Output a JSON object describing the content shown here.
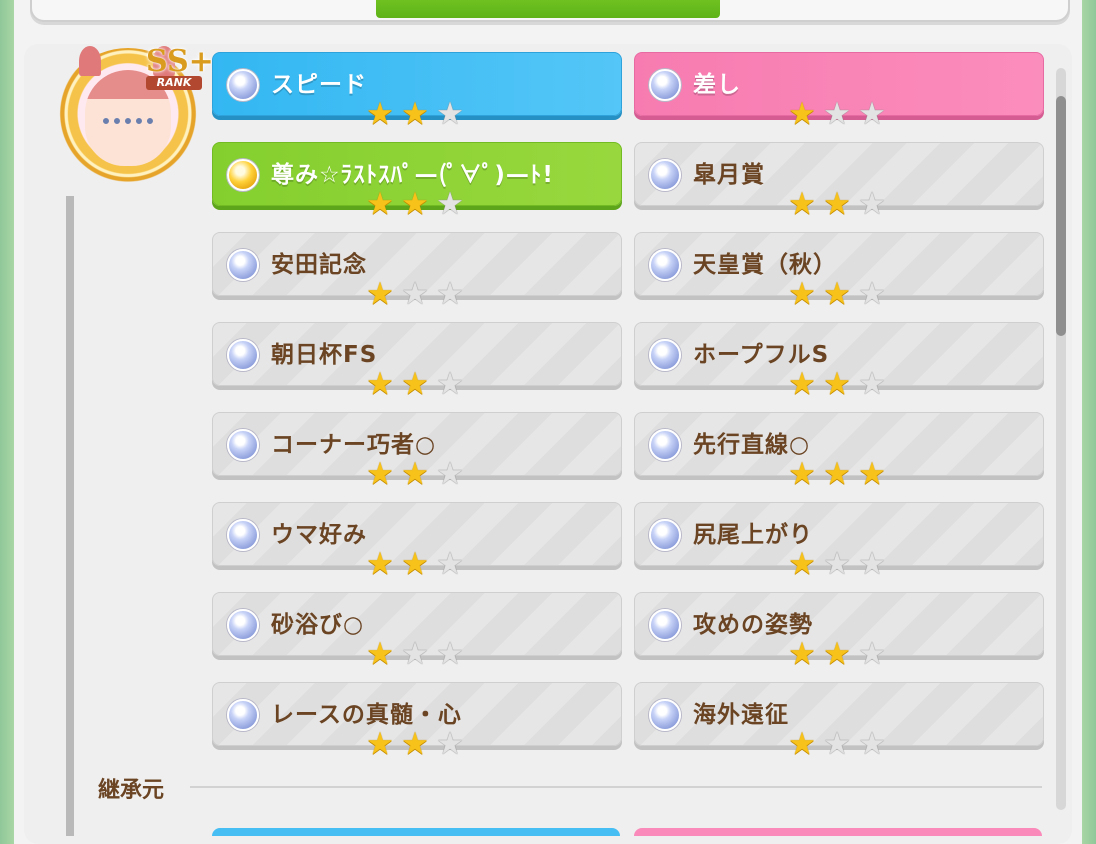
{
  "tabs": [
    "",
    "",
    ""
  ],
  "rank": {
    "badge": "SS+",
    "label": "RANK"
  },
  "skills": [
    {
      "name": "スピード",
      "stars": 2,
      "style": "blue",
      "orb": "blue"
    },
    {
      "name": "差し",
      "stars": 1,
      "style": "pink",
      "orb": "blue"
    },
    {
      "name": "尊み☆ﾗｽﾄｽﾊﾟ—(ﾟ∀ﾟ)—ﾄ!",
      "stars": 2,
      "style": "green",
      "orb": "gold"
    },
    {
      "name": "皐月賞",
      "stars": 2,
      "style": "gray",
      "orb": "blue"
    },
    {
      "name": "安田記念",
      "stars": 1,
      "style": "gray",
      "orb": "blue"
    },
    {
      "name": "天皇賞（秋）",
      "stars": 2,
      "style": "gray",
      "orb": "blue"
    },
    {
      "name": "朝日杯FS",
      "stars": 2,
      "style": "gray",
      "orb": "blue"
    },
    {
      "name": "ホープフルS",
      "stars": 2,
      "style": "gray",
      "orb": "blue"
    },
    {
      "name": "コーナー巧者○",
      "stars": 2,
      "style": "gray",
      "orb": "blue"
    },
    {
      "name": "先行直線○",
      "stars": 3,
      "style": "gray",
      "orb": "blue"
    },
    {
      "name": "ウマ好み",
      "stars": 2,
      "style": "gray",
      "orb": "blue"
    },
    {
      "name": "尻尾上がり",
      "stars": 1,
      "style": "gray",
      "orb": "blue"
    },
    {
      "name": "砂浴び○",
      "stars": 1,
      "style": "gray",
      "orb": "blue"
    },
    {
      "name": "攻めの姿勢",
      "stars": 2,
      "style": "gray",
      "orb": "blue"
    },
    {
      "name": "レースの真髄・心",
      "stars": 2,
      "style": "gray",
      "orb": "blue"
    },
    {
      "name": "海外遠征",
      "stars": 1,
      "style": "gray",
      "orb": "blue"
    }
  ],
  "section": {
    "title": "継承元"
  },
  "colors": {
    "accent_green": "#6dbf1e",
    "speed_blue": "#33b7f2",
    "style_pink": "#f77bb0",
    "text_brown": "#6a4423",
    "star_gold": "#f7c31a"
  }
}
